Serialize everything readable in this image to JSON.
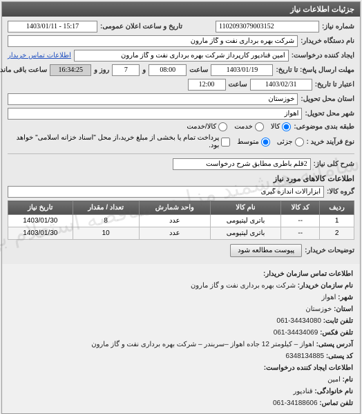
{
  "panel_title": "جزئیات اطلاعات نیاز",
  "labels": {
    "need_no": "شماره نیاز:",
    "announce_dt": "تاریخ و ساعت اعلان عمومی:",
    "buyer_org": "نام دستگاه خریدار:",
    "requester": "ایجاد کننده درخواست:",
    "contact_link": "اطلاعات تماس خریدار",
    "reply_deadline": "مهلت ارسال پاسخ: تا تاریخ:",
    "hour": "ساعت",
    "and": "و",
    "days": "روز و",
    "remaining": "ساعت باقی مانده",
    "validity": "اعتبار تا تاریخ:",
    "province": "استان محل تحویل:",
    "city": "شهر محل تحویل:",
    "subject_type": "طبقه بندی موضوعی:",
    "goods": "کالا",
    "service": "خدمت",
    "goods_service": "کالا/خدمت",
    "buy_process": "نوع فرآیند خرید :",
    "low": "جزئی",
    "mid": "متوسط",
    "mid_note": "پرداخت تمام یا بخشی از مبلغ خرید،از محل \"اسناد خزانه اسلامی\" خواهد بود.",
    "need_desc": "شرح کلی نیاز:",
    "items_title": "اطلاعات کالاهای مورد نیاز",
    "group": "گروه کالا:",
    "buyer_notes": "توضیحات خریدار:",
    "attach_btn": "پیوست مطالعه شود",
    "footer_title": "اطلاعات تماس سازمان خریدار:",
    "org_name_l": "نام سازمان خریدار:",
    "city_l": "شهر:",
    "province_l": "استان:",
    "phone_l": "تلفن ثابت:",
    "fax_l": "تلفن فکس:",
    "address_l": "آدرس پستی:",
    "postal_l": "کد پستی:",
    "req_title": "اطلاعات ایجاد کننده درخواست:",
    "fname_l": "نام:",
    "lname_l": "نام خانوادگی:",
    "contact_phone_l": "تلفن تماس:"
  },
  "values": {
    "need_no": "1102093079003152",
    "announce_dt": "1403/01/11 - 15:17",
    "buyer_org": "شرکت بهره برداری نفت و گاز مارون",
    "requester": "امین قنادپور کارپرداز شرکت بهره برداری نفت و گاز مارون",
    "reply_date": "1403/01/19",
    "reply_hour": "08:00",
    "reply_days": "7",
    "reply_remain": "16:34:25",
    "validity_date": "1403/02/31",
    "validity_hour": "12:00",
    "province": "خوزستان",
    "city": "اهواز",
    "need_desc": "2قلم باطری مطابق شرح درخواست",
    "group": "ابزارآلات اندازه گیری"
  },
  "table": {
    "headers": {
      "row": "ردیف",
      "code": "کد کالا",
      "name": "نام کالا",
      "unit": "واحد شمارش",
      "qty": "تعداد / مقدار",
      "date": "تاریخ نیاز"
    },
    "rows": [
      {
        "row": "1",
        "code": "--",
        "name": "باتری لیتیومی",
        "unit": "عدد",
        "qty": "8",
        "date": "1403/01/30"
      },
      {
        "row": "2",
        "code": "--",
        "name": "باتری لیتیومی",
        "unit": "عدد",
        "qty": "10",
        "date": "1403/01/30"
      }
    ]
  },
  "footer": {
    "org_name": "شرکت بهره برداری نفت و گاز مارون",
    "city": "اهواز",
    "province": "خوزستان",
    "phone": "061-34434080",
    "fax": "061-34434069",
    "address": "اهواز – کیلومتر 12 جاده اهواز –سربندر – شرکت بهره برداری نفت و گاز مارون",
    "postal": "6348134885",
    "fname": "امین",
    "lname": "قنادپور",
    "contact_phone": "061-34188606"
  },
  "watermark": "اطلاعات پارس نماد\nسامانه هوشمند مزایده مناقصه استعلام بها\n۰۲۱-۸۸۳۴۹۶۷۰-۲"
}
